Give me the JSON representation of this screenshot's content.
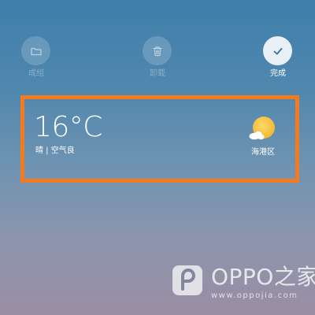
{
  "actions": {
    "group": {
      "label": "成组",
      "icon": "folder-icon",
      "state": "disabled"
    },
    "uninstall": {
      "label": "卸载",
      "icon": "trash-icon",
      "state": "disabled"
    },
    "done": {
      "label": "完成",
      "icon": "check-icon",
      "state": "enabled"
    }
  },
  "weather": {
    "temperature": "16°C",
    "condition_line": "晴 | 空气良",
    "city": "海港区",
    "icon": "sunny-partly-cloudy-icon"
  },
  "watermark": {
    "name": "OPPO之家",
    "url": "www.oppojia.com"
  },
  "colors": {
    "highlight_border": "#f47a20",
    "sun": "#f7c744"
  }
}
